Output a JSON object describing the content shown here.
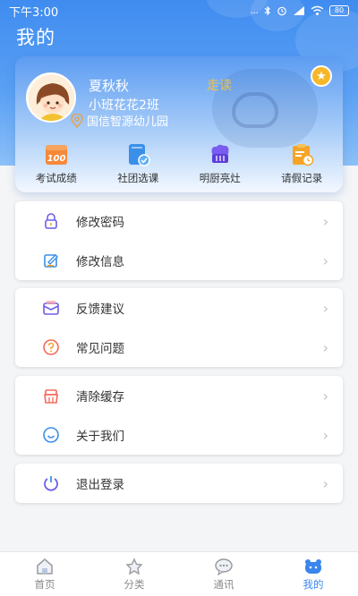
{
  "status_bar": {
    "time": "下午3:00",
    "signal": "...",
    "battery": "80"
  },
  "page": {
    "title": "我的"
  },
  "profile": {
    "name": "夏秋秋",
    "class": "小班花花2班",
    "school": "国信智源幼儿园",
    "tag": "走读"
  },
  "quick_actions": [
    {
      "label": "考试成绩",
      "icon": "exam-score-icon"
    },
    {
      "label": "社团选课",
      "icon": "club-course-icon"
    },
    {
      "label": "明厨亮灶",
      "icon": "kitchen-icon"
    },
    {
      "label": "请假记录",
      "icon": "leave-record-icon"
    }
  ],
  "menu_groups": [
    [
      {
        "label": "修改密码",
        "icon": "lock-icon"
      },
      {
        "label": "修改信息",
        "icon": "edit-icon"
      }
    ],
    [
      {
        "label": "反馈建议",
        "icon": "mail-icon"
      },
      {
        "label": "常见问题",
        "icon": "question-icon"
      }
    ],
    [
      {
        "label": "清除缓存",
        "icon": "broom-icon"
      },
      {
        "label": "关于我们",
        "icon": "smile-icon"
      }
    ],
    [
      {
        "label": "退出登录",
        "icon": "power-icon"
      }
    ]
  ],
  "tabs": [
    {
      "label": "首页",
      "icon": "home-icon"
    },
    {
      "label": "分类",
      "icon": "category-icon"
    },
    {
      "label": "通讯",
      "icon": "chat-icon"
    },
    {
      "label": "我的",
      "icon": "profile-icon",
      "active": true
    }
  ],
  "colors": {
    "primary": "#3f8cf0",
    "accent": "#f6b72a",
    "tag": "#f1c24a"
  }
}
